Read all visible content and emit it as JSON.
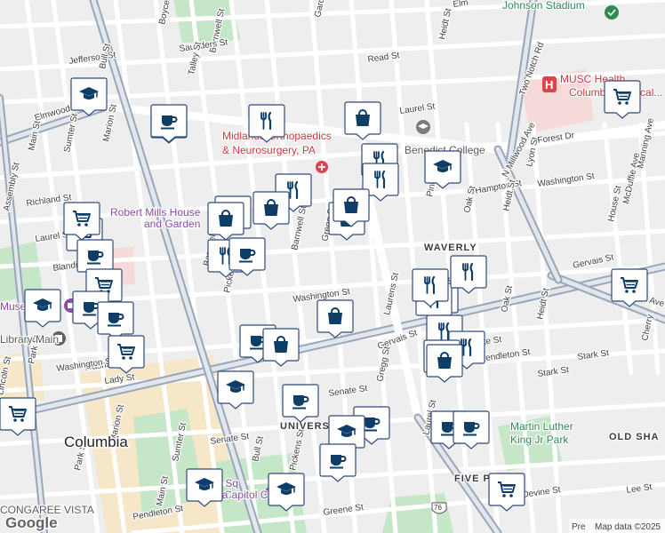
{
  "map": {
    "attribution": "Map data ©2025",
    "attribution_prefix": "Pre",
    "logo": "Google",
    "colors": {
      "background": "#eeeeef",
      "road": "#ffffff",
      "highway": "#9aa7b8",
      "park": "#c5e6c7",
      "campus": "#f5e7c8",
      "medical": "#f6d9d9",
      "marker_fill": "#ffffff",
      "marker_border": "#2f4a7a",
      "marker_icon": "#0e3d68"
    },
    "icon_semantics": [
      "restaurant-icon",
      "cafe-icon",
      "shopping-cart-icon",
      "shopping-bag-icon",
      "school-icon"
    ]
  },
  "labels": {
    "streets": [
      "Boyce St",
      "Barnwell St",
      "Saunders St",
      "Talley St",
      "Jefferson St",
      "Bull St",
      "Garden St",
      "Read St",
      "Heidt St",
      "Elm",
      "Laurel St",
      "Elmwood Ave",
      "Marion St",
      "Main St",
      "Sumter St",
      "Assembly St",
      "Richland St",
      "Laurel St",
      "Blanding St",
      "Taylor St",
      "Gregg St",
      "Barnwell St",
      "Washington St",
      "Hampton St",
      "Oak St",
      "Heidt St",
      "Pine St",
      "Washington St",
      "McDuffie Ave",
      "House St",
      "Manning Ave",
      "Lyon St",
      "Forest Dr",
      "Two Notch Rd",
      "N Millwood Ave",
      "Gervais St",
      "Millwood Ave",
      "Lady St",
      "Laurens St",
      "Senate St",
      "Pendleton St",
      "Oak St",
      "Heidt St",
      "Stark St",
      "Stark St",
      "Gervais St",
      "Gregg St",
      "Senate St",
      "Lady St",
      "Park St",
      "Lincoln St",
      "Park St",
      "Washington St",
      "Senate St",
      "Bull St",
      "Pickens St",
      "Sumter St",
      "Pendleton St",
      "Main St",
      "Greene St",
      "Laurel St",
      "Lee St",
      "Devine St",
      "Cherry",
      "Pickens St",
      "Marion St",
      "Washington St",
      "Barnwell St"
    ],
    "districts": [
      "WAVERLY",
      "OLD SHA",
      "FIVE POINTS",
      "UNIVERSITY"
    ],
    "city": "Columbia",
    "places": [
      "Johnson Stadium",
      "MUSC Health",
      "Columbia Medical...",
      "Midlands Orthopaedics",
      "& Neurosurgery, PA",
      "Benedict College",
      "Robert Mills House",
      "and Garden",
      "Martin Luther",
      "King Jr Park",
      "Capitol Ctr",
      "Vista",
      "Garden Sq",
      "CONGAREE VISTA",
      "Museum",
      "Library Main",
      "76"
    ]
  },
  "markers": [
    {
      "icon": "cafe-icon"
    },
    {
      "icon": "school-icon"
    },
    {
      "icon": "cafe-icon"
    },
    {
      "icon": "restaurant-icon"
    },
    {
      "icon": "shopping-bag-icon"
    },
    {
      "icon": "restaurant-icon"
    },
    {
      "icon": "school-icon"
    },
    {
      "icon": "shopping-cart-icon"
    },
    {
      "icon": "restaurant-icon"
    },
    {
      "icon": "restaurant-icon"
    },
    {
      "icon": "restaurant-icon"
    },
    {
      "icon": "shopping-bag-icon"
    },
    {
      "icon": "shopping-bag-icon"
    },
    {
      "icon": "shopping-bag-icon"
    },
    {
      "icon": "shopping-bag-icon"
    },
    {
      "icon": "restaurant-icon"
    },
    {
      "icon": "cafe-icon"
    },
    {
      "icon": "restaurant-icon"
    },
    {
      "icon": "shopping-cart-icon"
    },
    {
      "icon": "shopping-cart-icon"
    },
    {
      "icon": "cafe-icon"
    },
    {
      "icon": "shopping-cart-icon"
    },
    {
      "icon": "cafe-icon"
    },
    {
      "icon": "cafe-icon"
    },
    {
      "icon": "school-icon"
    },
    {
      "icon": "shopping-cart-icon"
    },
    {
      "icon": "shopping-bag-icon"
    },
    {
      "icon": "cafe-icon"
    },
    {
      "icon": "shopping-bag-icon"
    },
    {
      "icon": "restaurant-icon"
    },
    {
      "icon": "restaurant-icon"
    },
    {
      "icon": "restaurant-icon"
    },
    {
      "icon": "restaurant-icon"
    },
    {
      "icon": "shopping-cart-icon"
    },
    {
      "icon": "restaurant-icon"
    },
    {
      "icon": "shopping-bag-icon"
    },
    {
      "icon": "shopping-bag-icon"
    },
    {
      "icon": "school-icon"
    },
    {
      "icon": "cafe-icon"
    },
    {
      "icon": "cafe-icon"
    },
    {
      "icon": "school-icon"
    },
    {
      "icon": "cafe-icon"
    },
    {
      "icon": "cafe-icon"
    },
    {
      "icon": "cafe-icon"
    },
    {
      "icon": "shopping-cart-icon"
    },
    {
      "icon": "shopping-cart-icon"
    },
    {
      "icon": "school-icon"
    },
    {
      "icon": "school-icon"
    }
  ]
}
